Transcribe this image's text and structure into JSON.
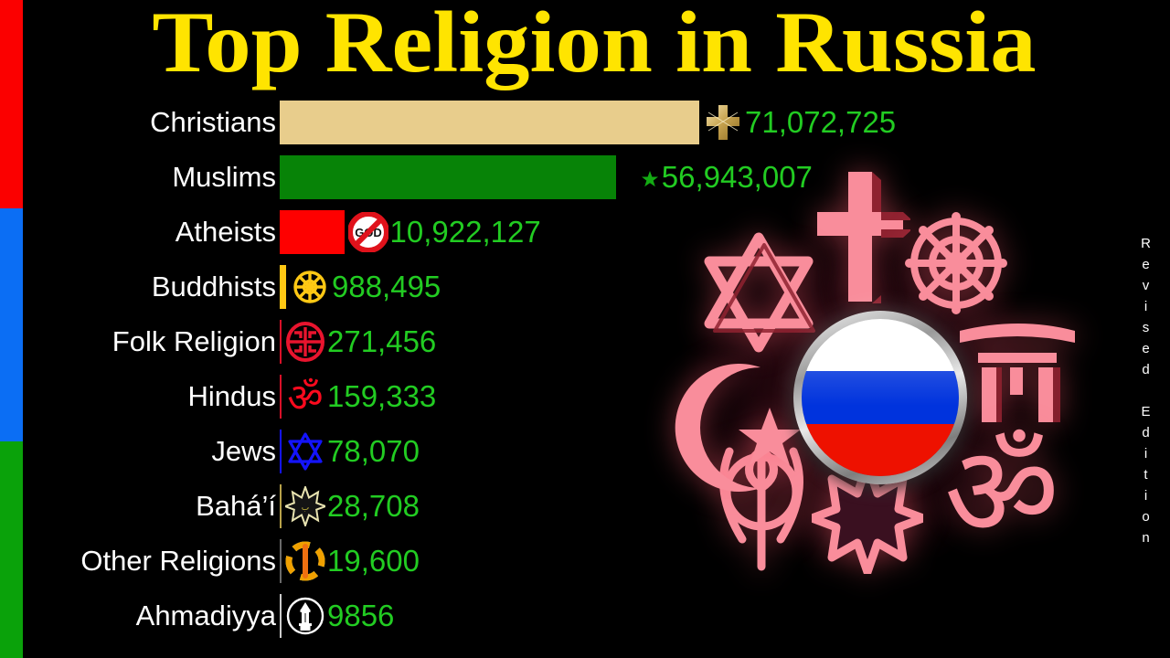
{
  "page": {
    "title": "Top Religion in Russia",
    "side_note": "Revised Edition",
    "background": "#000000",
    "title_color": "#ffe400",
    "value_color": "#22cc22",
    "label_color": "#ffffff"
  },
  "flag_strip": {
    "name": "russia-flag-strip",
    "segments": [
      {
        "color": "#fb0000",
        "label": "red"
      },
      {
        "color": "#0b6ef4",
        "label": "blue"
      },
      {
        "color": "#0aa20a",
        "label": "green"
      }
    ]
  },
  "chart_data": {
    "type": "bar",
    "title": "Top Religion in Russia",
    "xlabel": "",
    "ylabel": "",
    "orientation": "horizontal",
    "grid": false,
    "legend": "none",
    "xlim": [
      0,
      80000000
    ],
    "categories": [
      "Christians",
      "Muslims",
      "Atheists",
      "Buddhists",
      "Folk Religion",
      "Hindus",
      "Jews",
      "Bahá’í",
      "Other Religions",
      "Ahmadiyya"
    ],
    "values": [
      71072725,
      56943007,
      10922127,
      988495,
      271456,
      159333,
      78070,
      28708,
      19600,
      9856
    ],
    "value_labels": [
      "71,072,725",
      "56,943,007",
      "10,922,127",
      "988,495",
      "271,456",
      "159,333",
      "78,070",
      "28,708",
      "19,600",
      "9856"
    ],
    "bar_colors": [
      "#e8cd8c",
      "#078307",
      "#fe0000",
      "#ffc814",
      "#d81028",
      "#d81028",
      "#1414ff",
      "#b8a24a",
      "#6a6a6a",
      "#cccccc"
    ],
    "icons": [
      "christian-cross-icon",
      "islam-crescent-star-icon",
      "no-god-icon",
      "dharma-wheel-icon",
      "folk-religion-icon",
      "om-icon",
      "star-of-david-icon",
      "bahai-nine-pointed-star-icon",
      "other-religions-icon",
      "ahmadiyya-minaret-icon"
    ]
  },
  "artwork": {
    "name": "religion-symbols-wheel",
    "center_badge": "russia-flag-badge",
    "symbols": [
      "christian-cross-icon",
      "dharma-wheel-icon",
      "torii-gate-icon",
      "om-icon",
      "bahai-nine-pointed-star-icon",
      "khanda-icon",
      "islam-crescent-star-icon",
      "star-of-david-icon"
    ],
    "symbol_color": "#f98d9b"
  }
}
